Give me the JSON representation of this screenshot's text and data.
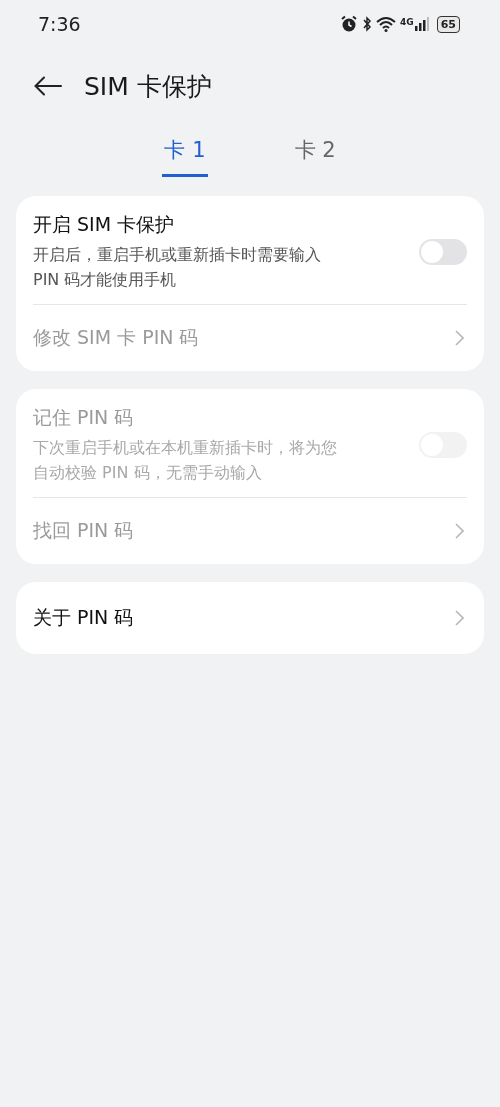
{
  "status_bar": {
    "time": "7:36",
    "network": "4G",
    "battery": "65"
  },
  "header": {
    "title": "SIM 卡保护"
  },
  "tabs": [
    {
      "label": "卡 1",
      "selected": true
    },
    {
      "label": "卡 2",
      "selected": false
    }
  ],
  "groups": [
    {
      "rows": [
        {
          "kind": "toggle",
          "title": "开启 SIM 卡保护",
          "description": "开启后，重启手机或重新插卡时需要输入 PIN 码才能使用手机",
          "on": false,
          "disabled": false
        },
        {
          "kind": "link",
          "title": "修改 SIM 卡 PIN 码",
          "disabled": true
        }
      ]
    },
    {
      "rows": [
        {
          "kind": "toggle",
          "title": "记住 PIN 码",
          "description": "下次重启手机或在本机重新插卡时，将为您自动校验 PIN 码，无需手动输入",
          "on": false,
          "disabled": true
        },
        {
          "kind": "link",
          "title": "找回 PIN 码",
          "disabled": true
        }
      ]
    },
    {
      "rows": [
        {
          "kind": "link",
          "title": "关于 PIN 码",
          "disabled": false
        }
      ]
    }
  ]
}
